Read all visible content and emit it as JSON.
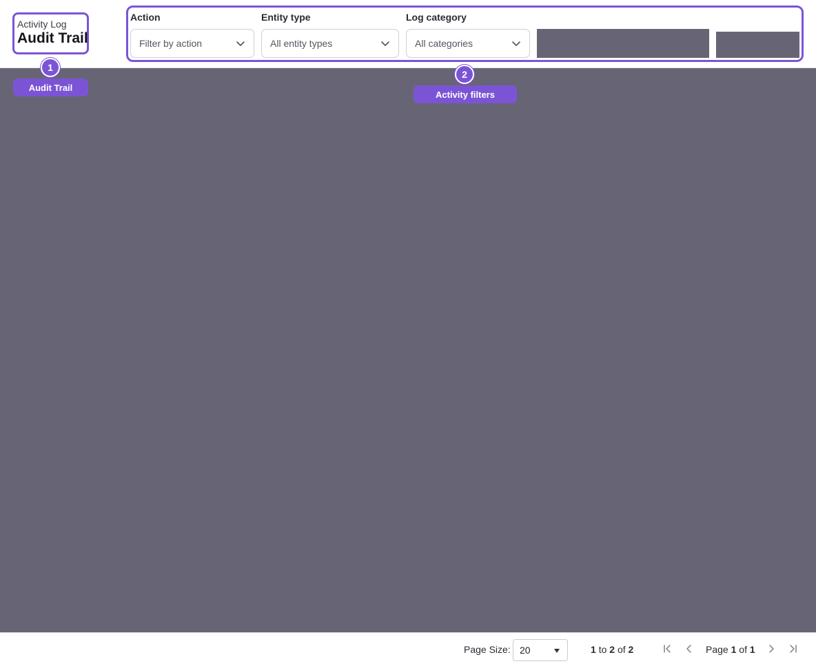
{
  "header": {
    "eyebrow": "Activity Log",
    "title": "Audit Trail"
  },
  "filters": {
    "action": {
      "label": "Action",
      "placeholder": "Filter by action"
    },
    "entity_type": {
      "label": "Entity type",
      "value": "All entity types"
    },
    "log_category": {
      "label": "Log category",
      "value": "All categories"
    }
  },
  "annotations": [
    {
      "number": "1",
      "label": "Audit Trail"
    },
    {
      "number": "2",
      "label": "Activity filters"
    }
  ],
  "pagination": {
    "page_size_label": "Page Size:",
    "page_size_value": "20",
    "range_from": "1",
    "range_to_word": "to",
    "range_to": "2",
    "range_of_word": "of",
    "range_total": "2",
    "page_word": "Page",
    "current_page": "1",
    "page_of_word": "of",
    "total_pages": "1"
  },
  "colors": {
    "accent": "#7b54d6",
    "overlay": "#676575"
  },
  "icons": [
    "chevron-down-icon",
    "caret-down-icon",
    "first-page-icon",
    "previous-page-icon",
    "next-page-icon",
    "last-page-icon"
  ]
}
